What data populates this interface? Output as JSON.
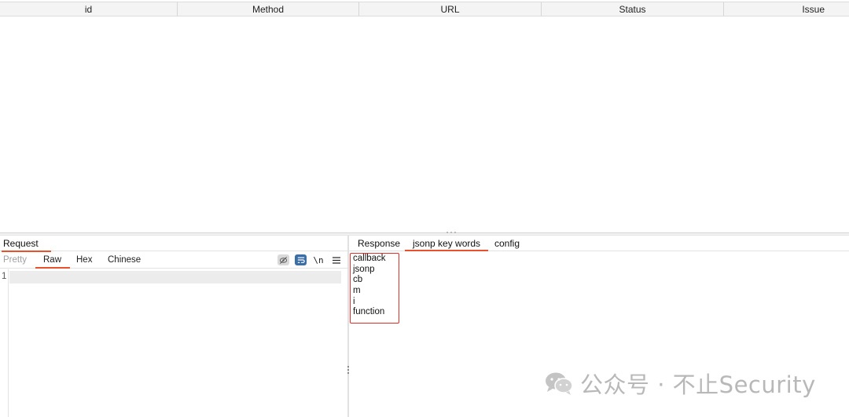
{
  "table": {
    "columns": [
      "id",
      "Method",
      "URL",
      "Status",
      "Issue"
    ],
    "rows": []
  },
  "request_pane": {
    "title": "Request",
    "view_tabs": [
      "Pretty",
      "Raw",
      "Hex",
      "Chinese"
    ],
    "active_view_tab": "Raw",
    "tools": {
      "hide_icon": "eye-slash-icon",
      "wrap_icon": "word-wrap-icon",
      "newline_label": "\\n",
      "menu_icon": "hamburger-menu-icon"
    },
    "editor": {
      "line_numbers": [
        "1"
      ],
      "content": ""
    }
  },
  "response_pane": {
    "tabs": [
      "Response",
      "jsonp key words",
      "config"
    ],
    "active_tab": "jsonp key words",
    "keywords": [
      "callback",
      "jsonp",
      "cb",
      "m",
      "i",
      "function"
    ]
  },
  "watermark": {
    "text": "公众号 · 不止Security",
    "icon": "wechat-icon"
  },
  "colors": {
    "accent_underline": "#e8512b",
    "keyword_box_border": "#e0302c",
    "wrap_button": "#3b6ea5"
  }
}
